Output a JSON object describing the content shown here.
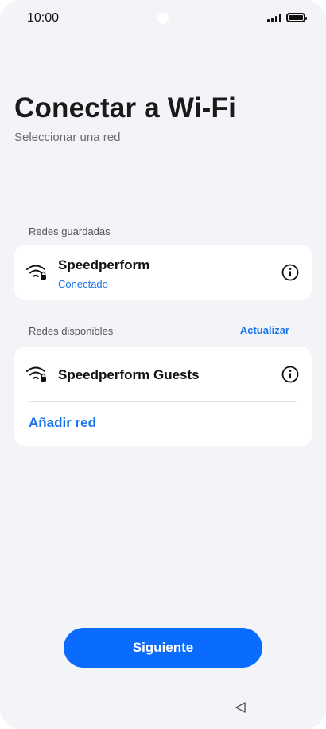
{
  "status_bar": {
    "time": "10:00"
  },
  "header": {
    "title": "Conectar a Wi-Fi",
    "subtitle": "Seleccionar una red"
  },
  "saved_networks": {
    "label": "Redes guardadas",
    "items": [
      {
        "name": "Speedperform",
        "status": "Conectado",
        "icon": "wifi-locked-icon"
      }
    ]
  },
  "available_networks": {
    "label": "Redes disponibles",
    "refresh_label": "Actualizar",
    "items": [
      {
        "name": "Speedperform Guests",
        "icon": "wifi-locked-icon"
      }
    ],
    "add_network_label": "Añadir red"
  },
  "footer": {
    "next_label": "Siguiente"
  },
  "colors": {
    "accent": "#1a73e8",
    "button": "#0a6cff",
    "background": "#f2f4f7"
  }
}
